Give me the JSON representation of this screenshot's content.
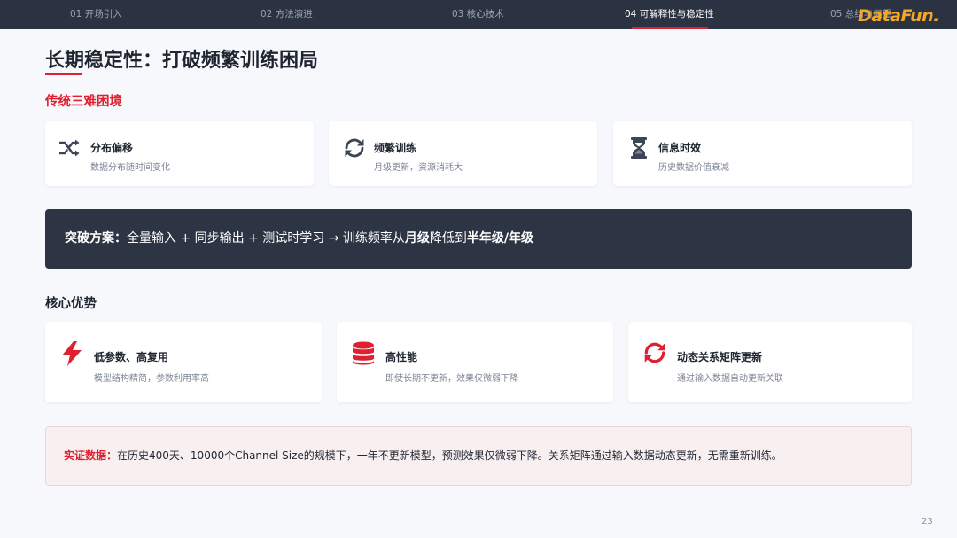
{
  "nav": {
    "tabs": [
      {
        "label": "01 开场引入",
        "active": false
      },
      {
        "label": "02 方法演进",
        "active": false
      },
      {
        "label": "03 核心技术",
        "active": false
      },
      {
        "label": "04 可解释性与稳定性",
        "active": true
      },
      {
        "label": "05 总结与展望",
        "active": false
      }
    ],
    "logo": "DataFun.",
    "accent": "#e02030"
  },
  "title": "长期稳定性：打破频繁训练困局",
  "problems": {
    "heading": "传统三难困境",
    "cards": [
      {
        "icon": "shuffle-icon",
        "title": "分布偏移",
        "desc": "数据分布随时间变化"
      },
      {
        "icon": "refresh-icon",
        "title": "频繁训练",
        "desc": "月级更新，资源消耗大"
      },
      {
        "icon": "hourglass-icon",
        "title": "信息时效",
        "desc": "历史数据价值衰减"
      }
    ]
  },
  "banner": {
    "lead": "突破方案：",
    "text1": "全量输入 + 同步输出 + 测试时学习 → 训练频率从",
    "bold1": "月级",
    "text2": "降低到",
    "bold2": "半年级/年级"
  },
  "advantages": {
    "heading": "核心优势",
    "cards": [
      {
        "icon": "lightning-icon",
        "title": "低参数、高复用",
        "desc": "模型结构精简，参数利用率高"
      },
      {
        "icon": "database-icon",
        "title": "高性能",
        "desc": "即使长期不更新，效果仅微弱下降"
      },
      {
        "icon": "sync-icon",
        "title": "动态关系矩阵更新",
        "desc": "通过输入数据自动更新关联"
      }
    ]
  },
  "evidence": {
    "lead": "实证数据：",
    "text": "在历史400天、10000个Channel Size的规模下，一年不更新模型，预测效果仅微弱下降。关系矩阵通过输入数据动态更新，无需重新训练。"
  },
  "page_number": "23"
}
